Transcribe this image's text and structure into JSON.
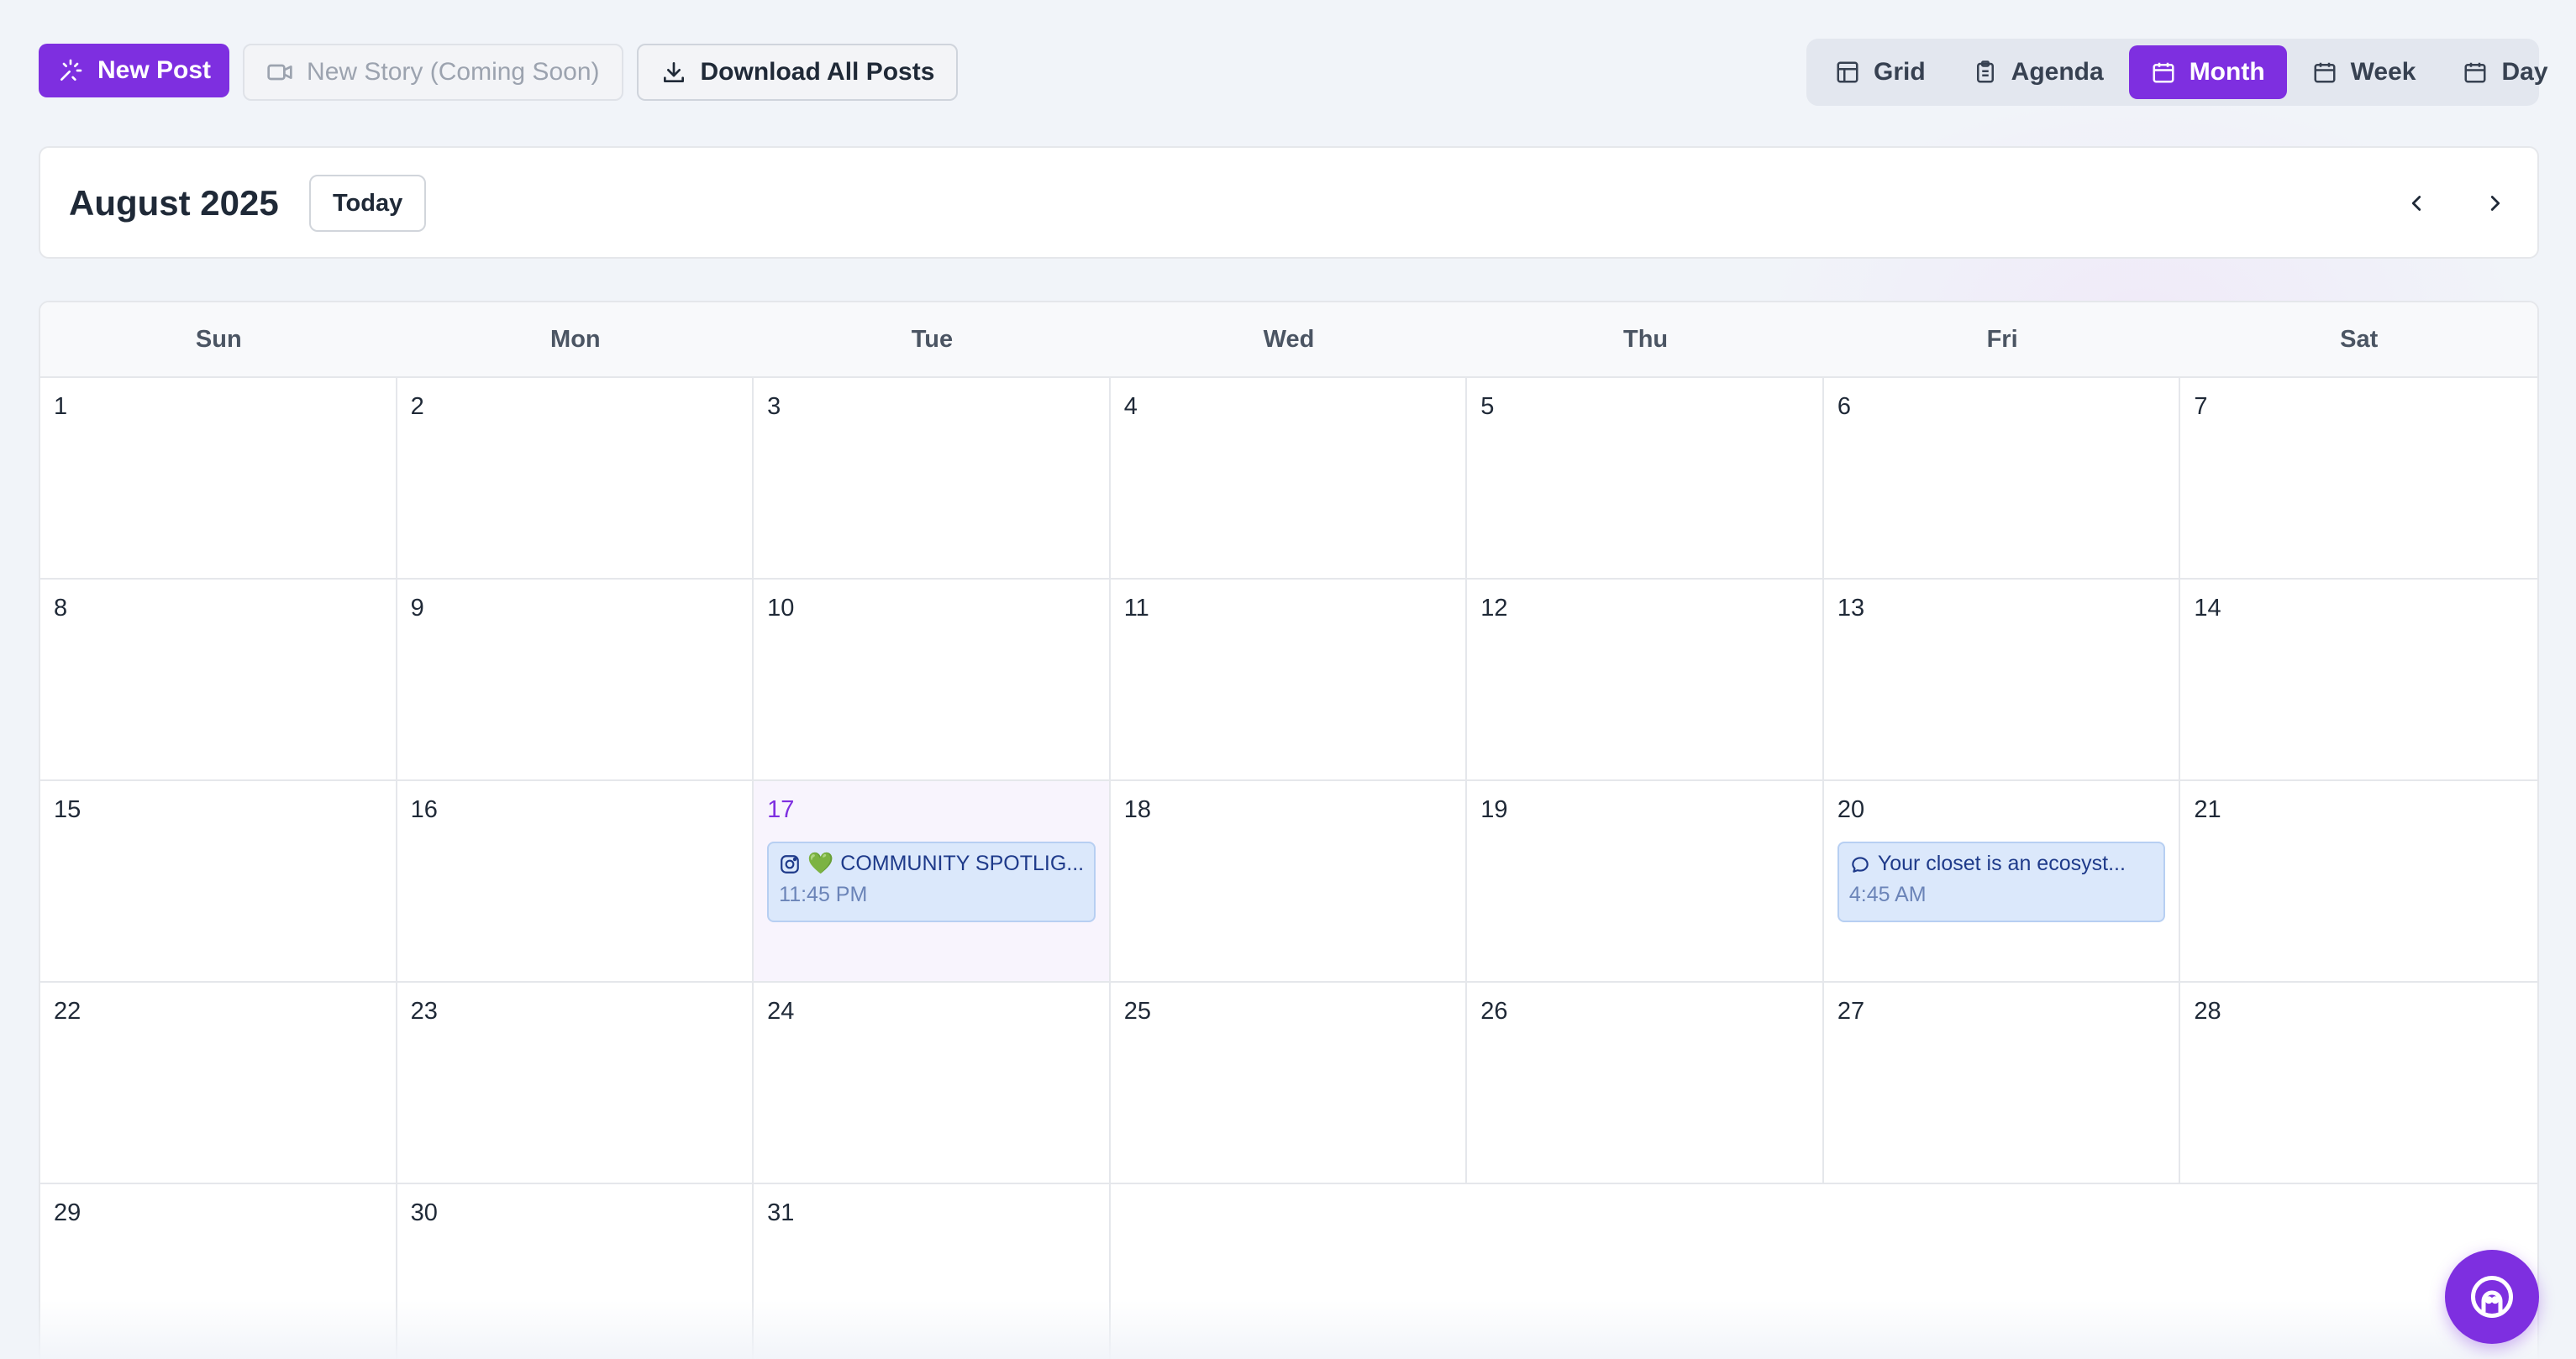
{
  "colors": {
    "accent": "#7e2fe0",
    "event_bg": "#dbe8fb",
    "today_bg": "#f8f4fd"
  },
  "toolbar": {
    "new_post": {
      "label": "New Post",
      "icon": "sparkle-pen-icon"
    },
    "new_story": {
      "label": "New Story (Coming Soon)",
      "icon": "video-camera-icon"
    },
    "download_all": {
      "label": "Download All Posts",
      "icon": "download-icon"
    }
  },
  "view_switch": {
    "active": "Month",
    "items": [
      {
        "label": "Grid",
        "icon": "grid-icon"
      },
      {
        "label": "Agenda",
        "icon": "clipboard-icon"
      },
      {
        "label": "Month",
        "icon": "calendar-icon"
      },
      {
        "label": "Week",
        "icon": "calendar-icon"
      },
      {
        "label": "Day",
        "icon": "calendar-icon"
      }
    ]
  },
  "header": {
    "month_title": "August 2025",
    "today_label": "Today",
    "prev_icon": "chevron-left-icon",
    "next_icon": "chevron-right-icon"
  },
  "calendar": {
    "weekdays": [
      "Sun",
      "Mon",
      "Tue",
      "Wed",
      "Thu",
      "Fri",
      "Sat"
    ],
    "today": "17",
    "days": [
      "1",
      "2",
      "3",
      "4",
      "5",
      "6",
      "7",
      "8",
      "9",
      "10",
      "11",
      "12",
      "13",
      "14",
      "15",
      "16",
      "17",
      "18",
      "19",
      "20",
      "21",
      "22",
      "23",
      "24",
      "25",
      "26",
      "27",
      "28",
      "29",
      "30",
      "31"
    ],
    "events": [
      {
        "day": "17",
        "icon": "instagram-icon",
        "emoji": "💚",
        "title": "COMMUNITY SPOTLIG...",
        "time": "11:45 PM"
      },
      {
        "day": "20",
        "icon": "chat-bubble-icon",
        "emoji": "",
        "title": "Your closet is an ecosyst...",
        "time": "4:45 AM"
      }
    ]
  },
  "assistant_button": {
    "icon": "assistant-face-icon"
  }
}
